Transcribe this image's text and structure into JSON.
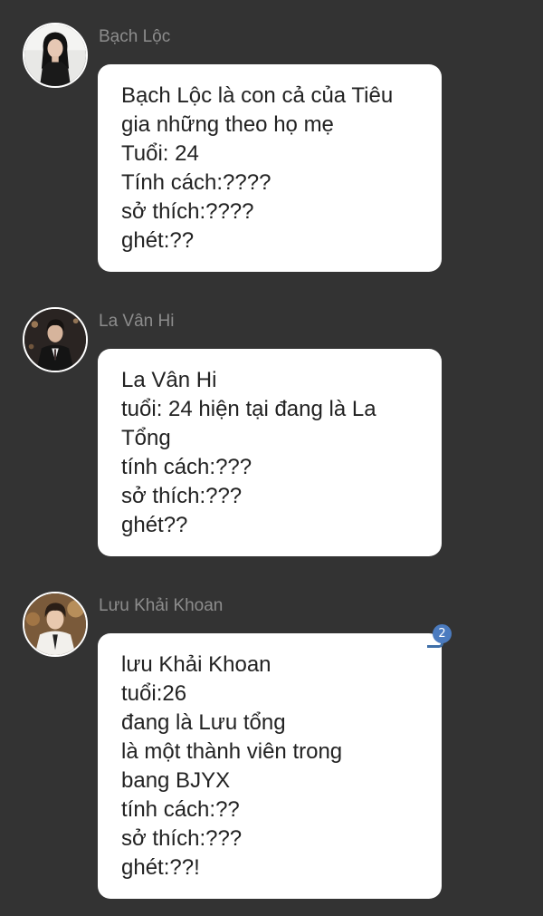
{
  "messages": [
    {
      "sender": "Bạch Lộc",
      "avatar_icon": "profile-photo-woman-dark-hair",
      "lines": [
        "Bạch Lộc là con cả của Tiêu",
        "gia những theo họ mẹ",
        "Tuổi: 24",
        "Tính cách:????",
        "sở thích:????",
        "ghét:??"
      ]
    },
    {
      "sender": "La Vân Hi",
      "avatar_icon": "profile-photo-man-suit",
      "lines": [
        "La Vân Hi",
        "tuổi: 24 hiện tại đang là La",
        "Tổng",
        "tính cách:???",
        "sở thích:???",
        "ghét??"
      ]
    },
    {
      "sender": "Lưu Khải Khoan",
      "avatar_icon": "profile-photo-man-warm-light",
      "badge_count": "2",
      "lines": [
        "lưu Khải Khoan",
        "tuổi:26",
        "đang là Lưu tổng",
        "là một thành viên trong",
        "bang BJYX",
        "tính cách:??",
        "sở thích:???",
        "ghét:??!"
      ]
    }
  ],
  "colors": {
    "background": "#333333",
    "bubble": "#ffffff",
    "sender_name": "#8d8d8d",
    "text": "#222222",
    "badge": "#4b7bbf"
  }
}
